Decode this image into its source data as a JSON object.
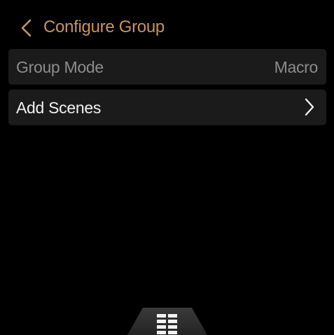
{
  "header": {
    "title": "Configure Group",
    "back_icon": "chevron-left-icon"
  },
  "rows": [
    {
      "label": "Group Mode",
      "value": "Macro"
    },
    {
      "label": "Add Scenes",
      "icon": "chevron-right-icon"
    }
  ],
  "bottom_tab": {
    "icon": "grid-menu-icon"
  },
  "colors": {
    "background": "#000000",
    "accent": "#c8935e",
    "row_background": "#1b1b1b",
    "muted_text": "#8c8c8c",
    "primary_text": "#f0f0f0"
  }
}
